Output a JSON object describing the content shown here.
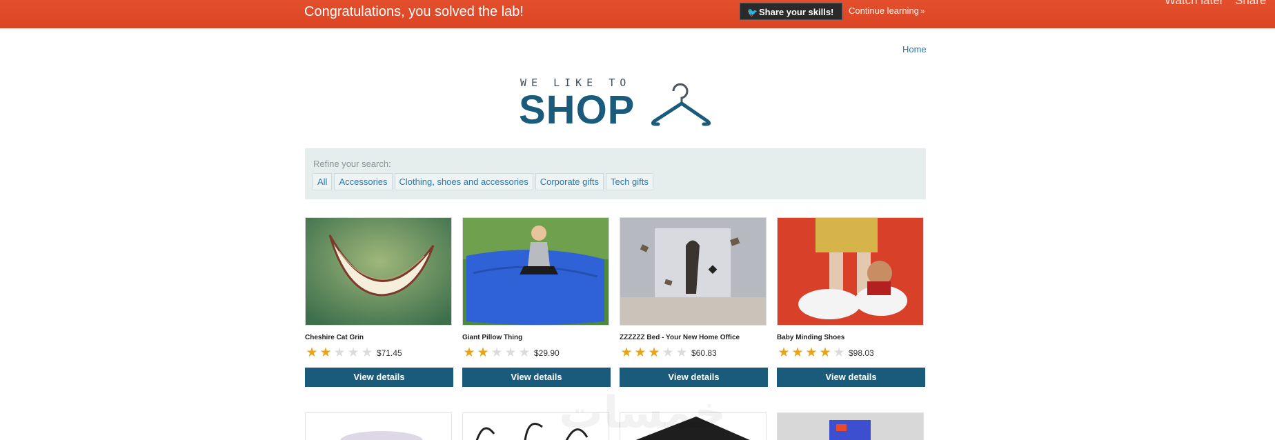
{
  "banner": {
    "message": "Congratulations, you solved the lab!",
    "share_label": "Share your skills!",
    "continue_label": "Continue learning",
    "video_watch_later": "Watch later",
    "video_share": "Share",
    "color": "#e04a28"
  },
  "nav": {
    "home": "Home"
  },
  "logo": {
    "small": "WE LIKE TO",
    "big": "SHOP",
    "color": "#1a5a7a"
  },
  "filter": {
    "label": "Refine your search:",
    "categories": [
      "All",
      "Accessories",
      "Clothing, shoes and accessories",
      "Corporate gifts",
      "Tech gifts"
    ]
  },
  "products": [
    {
      "name": "Cheshire Cat Grin",
      "price": "$71.45",
      "rating": 2,
      "button": "View details"
    },
    {
      "name": "Giant Pillow Thing",
      "price": "$29.90",
      "rating": 2,
      "button": "View details"
    },
    {
      "name": "ZZZZZZ Bed - Your New Home Office",
      "price": "$60.83",
      "rating": 3,
      "button": "View details"
    },
    {
      "name": "Baby Minding Shoes",
      "price": "$98.03",
      "rating": 4,
      "button": "View details"
    }
  ],
  "rating_max": 5,
  "watermark": "خمسات",
  "icons": [
    "twitter-bird-icon",
    "double-chevron-right-icon",
    "hanger-icon",
    "star-icon"
  ]
}
